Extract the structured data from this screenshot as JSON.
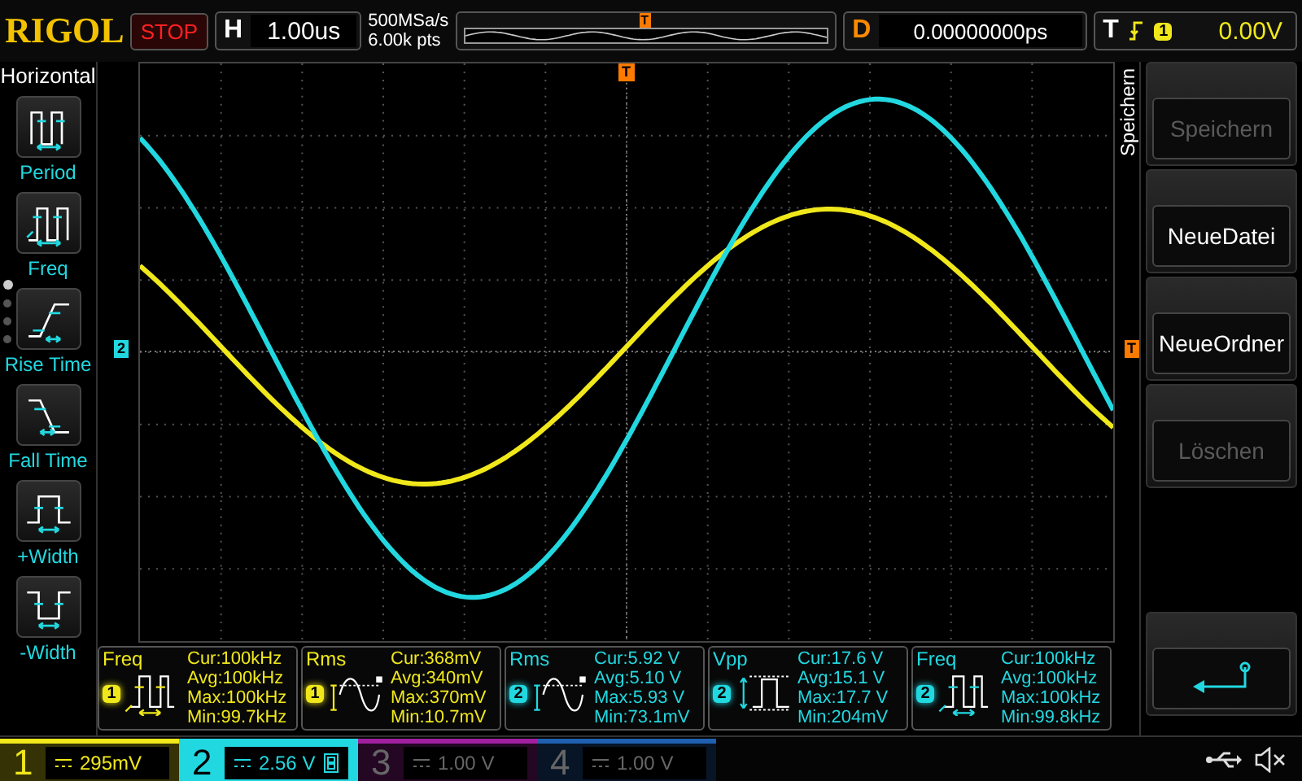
{
  "header": {
    "brand": "RIGOL",
    "run_state": "STOP",
    "timebase_label": "H",
    "timebase": "1.00us",
    "sample_rate": "500MSa/s",
    "memory_depth": "6.00k pts",
    "overview_trigger": "T",
    "delay_label": "D",
    "delay": "0.00000000ps",
    "trigger_label": "T",
    "trigger_source": "1",
    "trigger_level": "0.00V"
  },
  "left_menu": {
    "title": "Horizontal",
    "items": [
      {
        "kind": "period",
        "label": "Period"
      },
      {
        "kind": "freq",
        "label": "Freq"
      },
      {
        "kind": "rise",
        "label": "Rise Time"
      },
      {
        "kind": "fall",
        "label": "Fall Time"
      },
      {
        "kind": "pwidth",
        "label": "+Width"
      },
      {
        "kind": "nwidth",
        "label": "-Width"
      }
    ],
    "pages": [
      {
        "selected": true
      },
      {
        "selected": false
      },
      {
        "selected": false
      },
      {
        "selected": false
      }
    ]
  },
  "plot": {
    "trigger_position_marker": "T",
    "trigger_level_marker": "T",
    "channel_marker": "2",
    "traces": [
      {
        "color": "#f0e81a"
      },
      {
        "color": "#22d8e0"
      }
    ]
  },
  "measurements": [
    {
      "name": "Freq",
      "channel": "1",
      "kind": "freq",
      "color": "#f0e81a",
      "readings": [
        "Cur:100kHz",
        "Avg:100kHz",
        "Max:100kHz",
        "Min:99.7kHz"
      ]
    },
    {
      "name": "Rms",
      "channel": "1",
      "kind": "rms",
      "color": "#f0e81a",
      "readings": [
        "Cur:368mV",
        "Avg:340mV",
        "Max:370mV",
        "Min:10.7mV"
      ]
    },
    {
      "name": "Rms",
      "channel": "2",
      "kind": "rms",
      "color": "#22d8e0",
      "readings": [
        "Cur:5.92 V",
        "Avg:5.10 V",
        "Max:5.93 V",
        "Min:73.1mV"
      ]
    },
    {
      "name": "Vpp",
      "channel": "2",
      "kind": "vpp",
      "color": "#22d8e0",
      "readings": [
        "Cur:17.6 V",
        "Avg:15.1 V",
        "Max:17.7 V",
        "Min:204mV"
      ]
    },
    {
      "name": "Freq",
      "channel": "2",
      "kind": "freq",
      "color": "#22d8e0",
      "readings": [
        "Cur:100kHz",
        "Avg:100kHz",
        "Max:100kHz",
        "Min:99.8kHz"
      ]
    }
  ],
  "right_menu": {
    "title": "Speichern",
    "items": [
      {
        "label": "Speichern",
        "disabled": true
      },
      {
        "label": "NeueDatei",
        "disabled": false
      },
      {
        "label": "NeueOrdner",
        "disabled": false
      },
      {
        "label": "Löschen",
        "disabled": true
      }
    ]
  },
  "channels": [
    {
      "number": "1",
      "scale": "295mV",
      "color": "#f0e81a",
      "on": true,
      "selected": false,
      "bandwidth_limit": false
    },
    {
      "number": "2",
      "scale": "2.56 V",
      "color": "#22d8e0",
      "on": true,
      "selected": true,
      "bandwidth_limit": true
    },
    {
      "number": "3",
      "scale": "1.00 V",
      "color": "#a020a0",
      "on": false,
      "selected": false,
      "bandwidth_limit": false
    },
    {
      "number": "4",
      "scale": "1.00 V",
      "color": "#2060b0",
      "on": false,
      "selected": false,
      "bandwidth_limit": false
    }
  ],
  "status": {
    "usb_connected": true,
    "muted": true
  }
}
